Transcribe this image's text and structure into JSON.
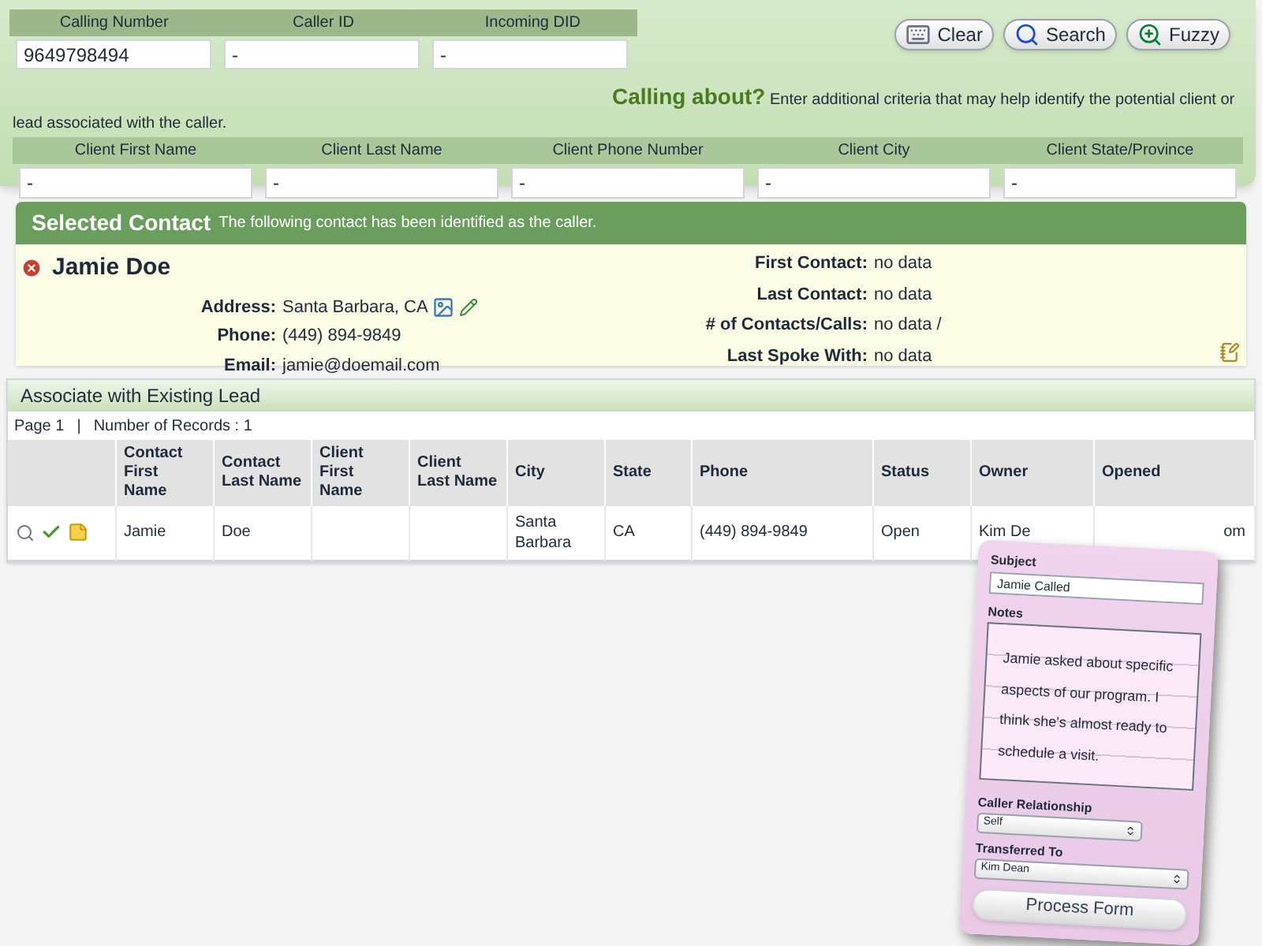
{
  "search": {
    "caller_fields": [
      {
        "label": "Calling Number",
        "value": "9649798494"
      },
      {
        "label": "Caller ID",
        "value": "-"
      },
      {
        "label": "Incoming DID",
        "value": "-"
      }
    ],
    "buttons": [
      {
        "label": "Clear",
        "kind": "clear"
      },
      {
        "label": "Search",
        "kind": "search"
      },
      {
        "label": "Fuzzy",
        "kind": "fuzzy"
      }
    ],
    "calling_about": {
      "title": "Calling about?",
      "text": "Enter additional criteria that may help identify the potential client or lead associated with the caller."
    },
    "client_fields": [
      {
        "label": "Client First Name",
        "value": "-"
      },
      {
        "label": "Client Last Name",
        "value": "-"
      },
      {
        "label": "Client Phone Number",
        "value": "-"
      },
      {
        "label": "Client City",
        "value": "-"
      },
      {
        "label": "Client State/Province",
        "value": "-"
      }
    ]
  },
  "selected_contact": {
    "title": "Selected Contact",
    "subtitle": "The following contact has been identified as the caller.",
    "name": "Jamie Doe",
    "details": [
      {
        "label": "Address:",
        "value": "Santa Barbara, CA",
        "kind": "address"
      },
      {
        "label": "Phone:",
        "value": "(449) 894-9849",
        "kind": "plain"
      },
      {
        "label": "Email:",
        "value": "jamie@doemail.com",
        "kind": "plain"
      }
    ],
    "history": [
      {
        "label": "First Contact:",
        "value": "no data"
      },
      {
        "label": "Last Contact:",
        "value": "no data"
      },
      {
        "label": "# of Contacts/Calls:",
        "value": "no data /"
      },
      {
        "label": "Last Spoke With:",
        "value": "no data"
      }
    ]
  },
  "leads": {
    "title": "Associate with Existing Lead",
    "page": "Page 1",
    "separator": "|",
    "records": "Number of Records : 1",
    "columns": [
      "Contact First Name",
      "Contact Last Name",
      "Client First Name",
      "Client Last Name",
      "City",
      "State",
      "Phone",
      "Status",
      "Owner",
      "Opened"
    ],
    "rows": [
      {
        "cells": [
          "Jamie",
          "Doe",
          "",
          "",
          "Santa Barbara",
          "CA",
          "(449) 894-9849",
          "Open",
          "Kim De",
          "om"
        ]
      }
    ]
  },
  "call_form": {
    "subject_label": "Subject",
    "subject": "Jamie Called",
    "notes_label": "Notes",
    "notes": "Jamie asked about specific aspects of our program. I think she's almost ready to schedule a visit.",
    "relationship_label": "Caller Relationship",
    "relationship": "Self",
    "transferred_label": "Transferred To",
    "transferred": "Kim Dean",
    "button": "Process Form"
  }
}
